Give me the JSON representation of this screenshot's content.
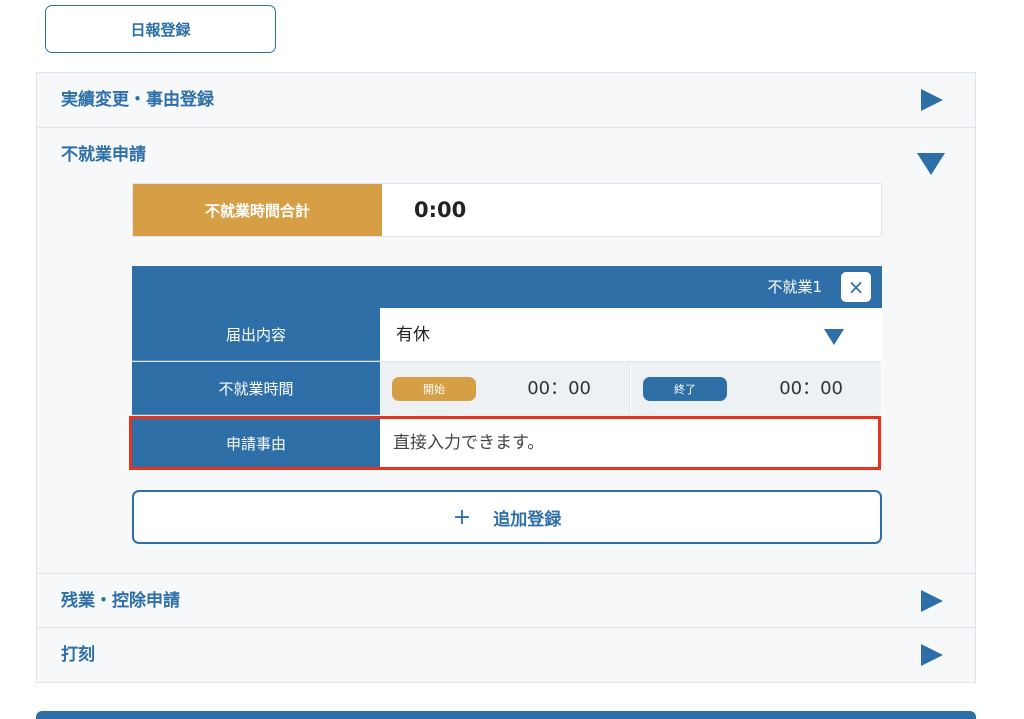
{
  "top_button": {
    "label": "日報登録"
  },
  "accordion": {
    "section1": {
      "label": "実績変更・事由登録"
    },
    "section2": {
      "label": "不就業申請"
    },
    "section3": {
      "label": "残業・控除申請"
    },
    "section4": {
      "label": "打刻"
    }
  },
  "absence": {
    "total_label": "不就業時間合計",
    "total_value": "0:00",
    "card": {
      "title": "不就業1",
      "close_symbol": "×",
      "notification_label": "届出内容",
      "notification_value": "有休",
      "time_label": "不就業時間",
      "start_badge": "開始",
      "start_time": "00：00",
      "end_badge": "終了",
      "end_time": "00：00",
      "reason_label": "申請事由",
      "reason_placeholder": "直接入力できます。"
    },
    "add_button": {
      "plus": "+",
      "label": "追加登録"
    }
  },
  "colors": {
    "primary": "#2e6fa8",
    "accent": "#d69e45",
    "highlight_border": "#e9321c"
  },
  "icons": {
    "expand": "triangle-right-icon",
    "collapse": "triangle-down-icon",
    "close": "close-icon",
    "select": "chevron-down-icon",
    "add": "plus-icon"
  }
}
